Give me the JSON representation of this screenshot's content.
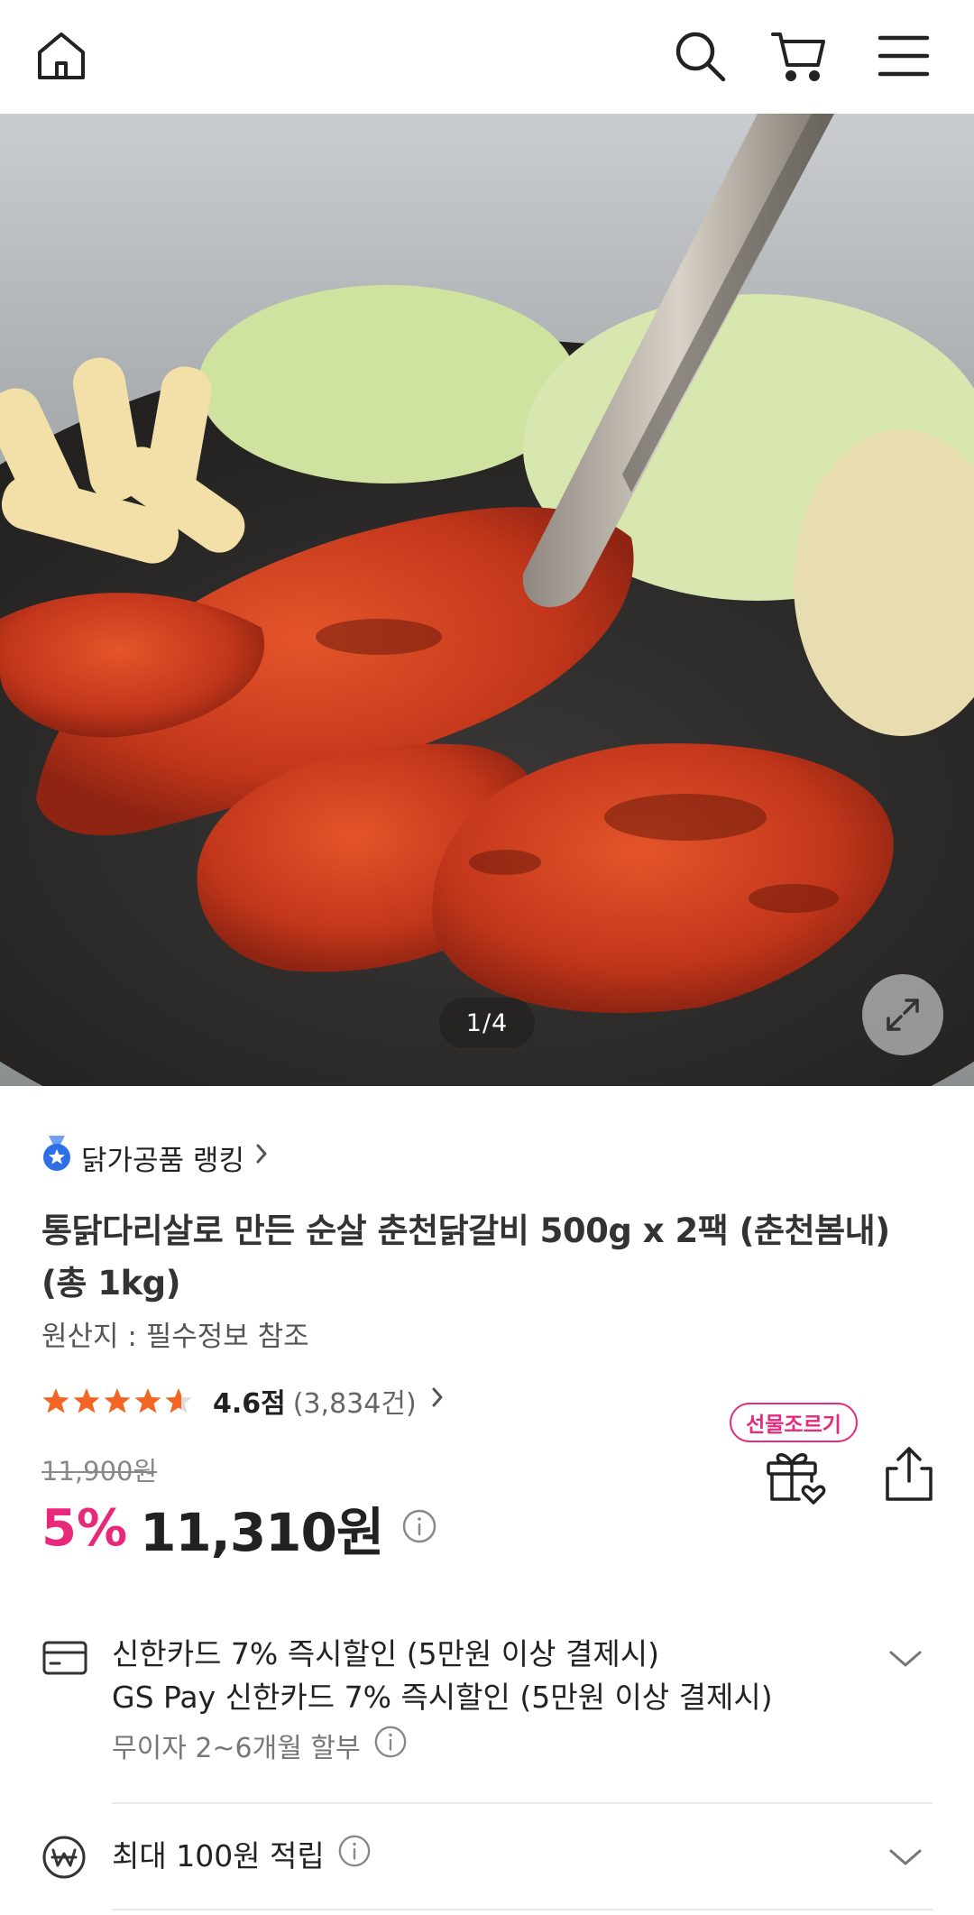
{
  "topbar": {
    "home_icon": "home-icon",
    "search_icon": "search-icon",
    "cart_icon": "cart-icon",
    "menu_icon": "menu-icon"
  },
  "gallery": {
    "pager": "1/4",
    "expand_icon": "expand-icon"
  },
  "product": {
    "ranking_label": "닭가공품 랭킹",
    "title": "통닭다리살로 만든 순살 춘천닭갈비 500g x 2팩 (춘천봄내) (총 1kg)",
    "origin": "원산지 : 필수정보 참조",
    "rating": {
      "stars": 4.6,
      "score_text": "4.6점",
      "count_text": "(3,834건)"
    },
    "original_price": "11,900원",
    "discount": "5%",
    "price": "11,310원"
  },
  "actions": {
    "gift_badge": "선물조르기",
    "gift_icon": "gift-heart-icon",
    "share_icon": "share-icon"
  },
  "benefits": {
    "card": {
      "icon": "credit-card-icon",
      "line1": "신한카드 7% 즉시할인 (5만원 이상 결제시)",
      "line2": "GS Pay 신한카드 7% 즉시할인 (5만원 이상 결제시)",
      "installment": "무이자 2~6개월 할부"
    },
    "points": {
      "icon": "won-coin-icon",
      "label": "최대 100원 적립"
    }
  },
  "colors": {
    "accent": "#e8287a",
    "star": "#f26522",
    "medal": "#2f6fe6"
  }
}
